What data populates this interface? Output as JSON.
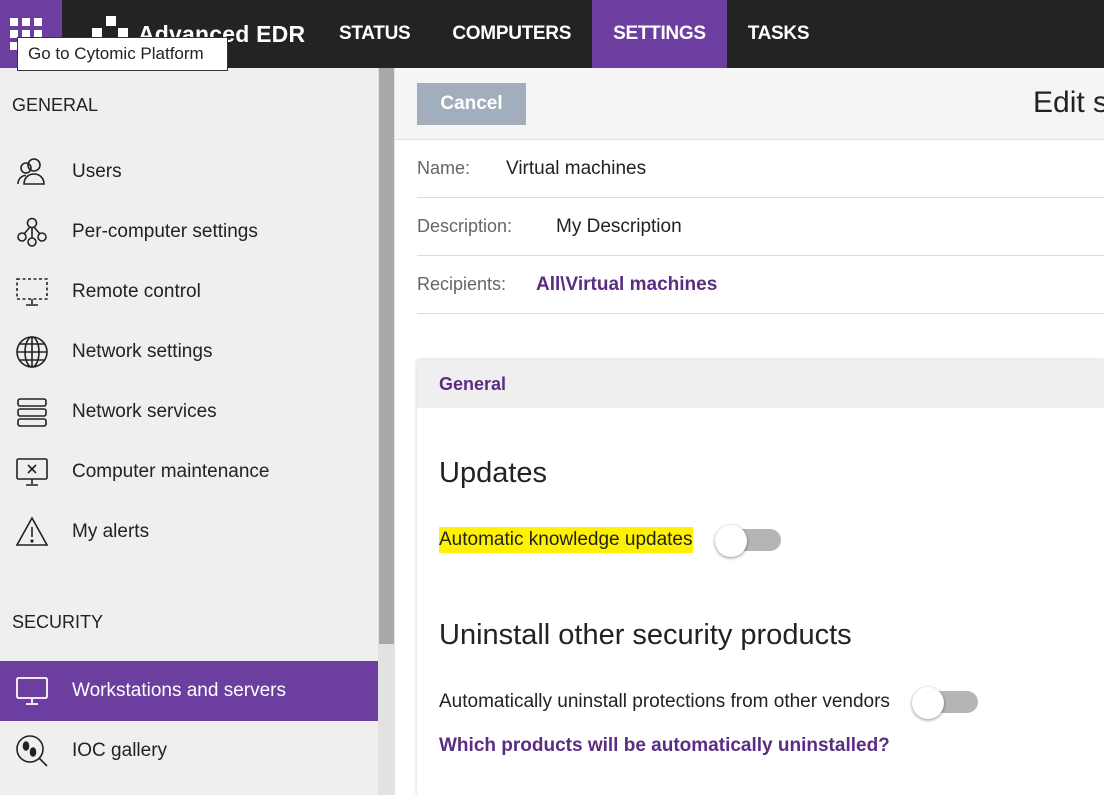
{
  "topbar": {
    "brand": "Advanced EDR",
    "tabs": [
      {
        "label": "STATUS",
        "active": false
      },
      {
        "label": "COMPUTERS",
        "active": false
      },
      {
        "label": "SETTINGS",
        "active": true
      },
      {
        "label": "TASKS",
        "active": false
      }
    ],
    "tooltip": "Go to Cytomic Platform"
  },
  "sidebar": {
    "general_title": "GENERAL",
    "general_items": [
      {
        "label": "Users",
        "icon": "users-icon"
      },
      {
        "label": "Per-computer settings",
        "icon": "nodes-icon"
      },
      {
        "label": "Remote control",
        "icon": "remote-monitor-icon"
      },
      {
        "label": "Network settings",
        "icon": "globe-icon"
      },
      {
        "label": "Network services",
        "icon": "server-stack-icon"
      },
      {
        "label": "Computer maintenance",
        "icon": "monitor-x-icon"
      },
      {
        "label": "My alerts",
        "icon": "warning-icon"
      }
    ],
    "security_title": "SECURITY",
    "security_items": [
      {
        "label": "Workstations and servers",
        "icon": "monitor-icon",
        "active": true
      },
      {
        "label": "IOC gallery",
        "icon": "footprint-search-icon",
        "active": false
      }
    ]
  },
  "toolbar": {
    "cancel_label": "Cancel",
    "title": "Edit s"
  },
  "fields": {
    "name_label": "Name:",
    "name_value": "Virtual machines",
    "description_label": "Description:",
    "description_value": "My Description",
    "recipients_label": "Recipients:",
    "recipients_value": "All\\Virtual machines"
  },
  "panel": {
    "header": "General",
    "updates_title": "Updates",
    "auto_updates_label": "Automatic knowledge updates",
    "auto_updates_on": false,
    "uninstall_title": "Uninstall other security products",
    "auto_uninstall_label": "Automatically uninstall protections from other vendors",
    "auto_uninstall_on": false,
    "products_link": "Which products will be automatically uninstalled?"
  },
  "colors": {
    "accent": "#6b3ea0",
    "link": "#5a2d82",
    "topbar": "#232323",
    "highlight": "#fff200"
  }
}
